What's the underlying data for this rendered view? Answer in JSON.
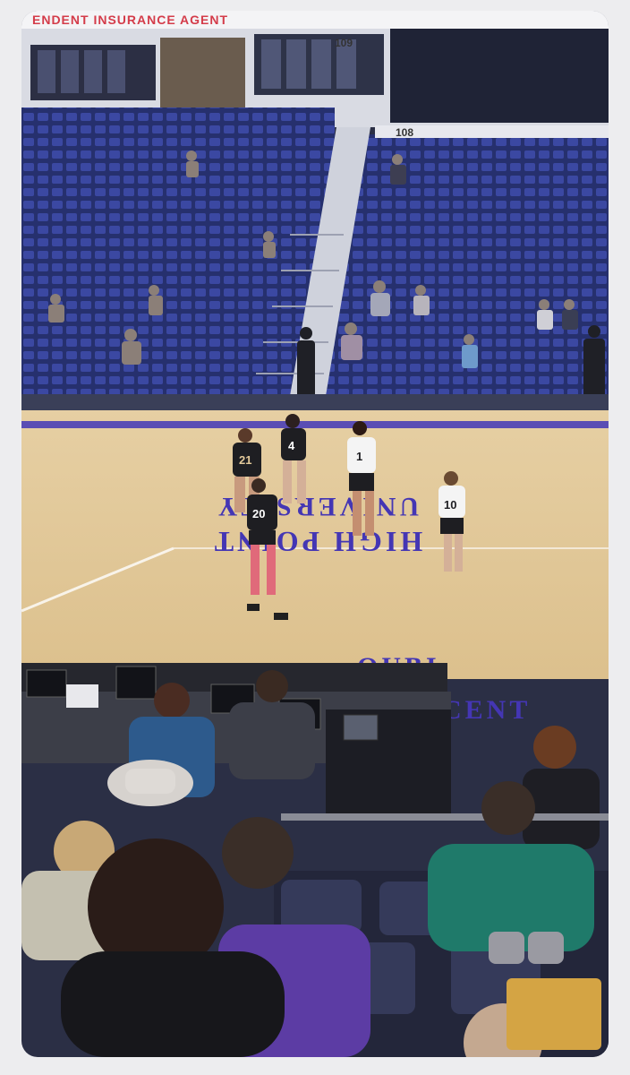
{
  "banner": {
    "text": "ENDENT INSURANCE AGENT"
  },
  "section_numbers": [
    "108",
    "109"
  ],
  "court": {
    "floor_text_main": "UNIVERSITY",
    "floor_text_main_2": "HIGH POINT",
    "floor_text_side": "QUBI",
    "floor_text_side_2": "CENT"
  },
  "players": [
    {
      "number": "21",
      "team": "dark"
    },
    {
      "number": "4",
      "team": "dark"
    },
    {
      "number": "20",
      "team": "dark"
    },
    {
      "number": "1",
      "team": "white"
    },
    {
      "number": "10",
      "team": "white"
    }
  ],
  "colors": {
    "seats": "#2f3a8c",
    "court_wood": "#e3c99a",
    "court_paint": "#4436b4",
    "dark_jersey": "#1e1e22",
    "white_jersey": "#f4f4f4",
    "banner_text": "#d43c4a"
  }
}
